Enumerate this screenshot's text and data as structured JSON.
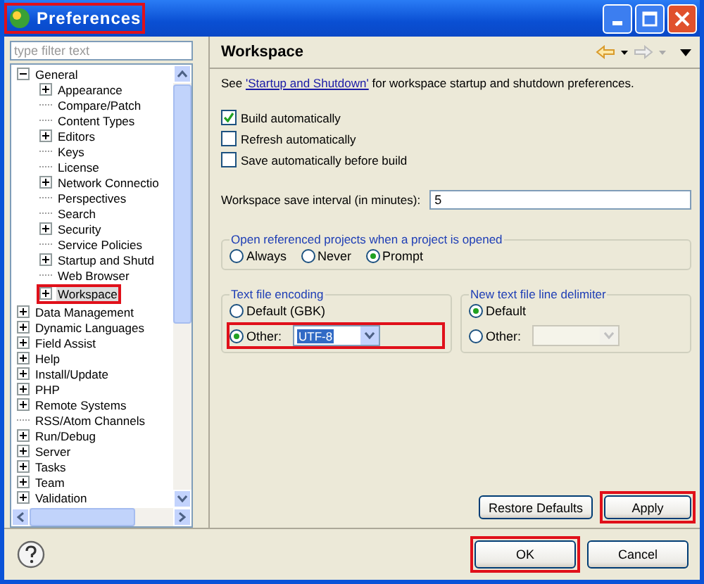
{
  "window": {
    "title": "Preferences"
  },
  "filter": {
    "placeholder": "type filter text"
  },
  "tree": [
    {
      "label": "General",
      "kind": "node",
      "expanded": true,
      "selected": false,
      "children": [
        {
          "label": "Appearance",
          "kind": "node",
          "expanded": false,
          "selected": false
        },
        {
          "label": "Compare/Patch",
          "kind": "leaf",
          "selected": false
        },
        {
          "label": "Content Types",
          "kind": "leaf",
          "selected": false
        },
        {
          "label": "Editors",
          "kind": "node",
          "expanded": false,
          "selected": false
        },
        {
          "label": "Keys",
          "kind": "leaf",
          "selected": false
        },
        {
          "label": "License",
          "kind": "leaf",
          "selected": false
        },
        {
          "label": "Network Connectio",
          "kind": "node",
          "expanded": false,
          "selected": false
        },
        {
          "label": "Perspectives",
          "kind": "leaf",
          "selected": false
        },
        {
          "label": "Search",
          "kind": "leaf",
          "selected": false
        },
        {
          "label": "Security",
          "kind": "node",
          "expanded": false,
          "selected": false
        },
        {
          "label": "Service Policies",
          "kind": "leaf",
          "selected": false
        },
        {
          "label": "Startup and Shutd",
          "kind": "node",
          "expanded": false,
          "selected": false
        },
        {
          "label": "Web Browser",
          "kind": "leaf",
          "selected": false
        },
        {
          "label": "Workspace",
          "kind": "node",
          "expanded": false,
          "selected": true
        }
      ]
    },
    {
      "label": "Data Management",
      "kind": "node",
      "expanded": false,
      "selected": false
    },
    {
      "label": "Dynamic Languages",
      "kind": "node",
      "expanded": false,
      "selected": false
    },
    {
      "label": "Field Assist",
      "kind": "node",
      "expanded": false,
      "selected": false
    },
    {
      "label": "Help",
      "kind": "node",
      "expanded": false,
      "selected": false
    },
    {
      "label": "Install/Update",
      "kind": "node",
      "expanded": false,
      "selected": false
    },
    {
      "label": "PHP",
      "kind": "node",
      "expanded": false,
      "selected": false
    },
    {
      "label": "Remote Systems",
      "kind": "node",
      "expanded": false,
      "selected": false
    },
    {
      "label": "RSS/Atom Channels",
      "kind": "leaf",
      "selected": false
    },
    {
      "label": "Run/Debug",
      "kind": "node",
      "expanded": false,
      "selected": false
    },
    {
      "label": "Server",
      "kind": "node",
      "expanded": false,
      "selected": false
    },
    {
      "label": "Tasks",
      "kind": "node",
      "expanded": false,
      "selected": false
    },
    {
      "label": "Team",
      "kind": "node",
      "expanded": false,
      "selected": false
    },
    {
      "label": "Validation",
      "kind": "node",
      "expanded": false,
      "selected": false
    }
  ],
  "page": {
    "title": "Workspace",
    "intro": {
      "before": "See ",
      "link": "'Startup and Shutdown'",
      "after": " for workspace startup and shutdown preferences."
    },
    "checkboxes": [
      {
        "label": "Build automatically",
        "checked": true
      },
      {
        "label": "Refresh automatically",
        "checked": false
      },
      {
        "label": "Save automatically before build",
        "checked": false
      }
    ],
    "interval": {
      "label": "Workspace save interval (in minutes):",
      "value": "5"
    },
    "open_projects": {
      "title": "Open referenced projects when a project is opened",
      "options": [
        {
          "label": "Always",
          "selected": false
        },
        {
          "label": "Never",
          "selected": false
        },
        {
          "label": "Prompt",
          "selected": true
        }
      ]
    },
    "encoding": {
      "title": "Text file encoding",
      "options": [
        {
          "label": "Default (GBK)",
          "selected": false
        },
        {
          "label": "Other:",
          "selected": true
        }
      ],
      "combo": {
        "value": "UTF-8",
        "disabled": false
      }
    },
    "delimiter": {
      "title": "New text file line delimiter",
      "options": [
        {
          "label": "Default",
          "selected": true
        },
        {
          "label": "Other:",
          "selected": false
        }
      ],
      "combo": {
        "disabled": true
      }
    },
    "buttons": [
      "Restore Defaults",
      "Apply"
    ]
  },
  "dialog_buttons": [
    "OK",
    "Cancel"
  ]
}
